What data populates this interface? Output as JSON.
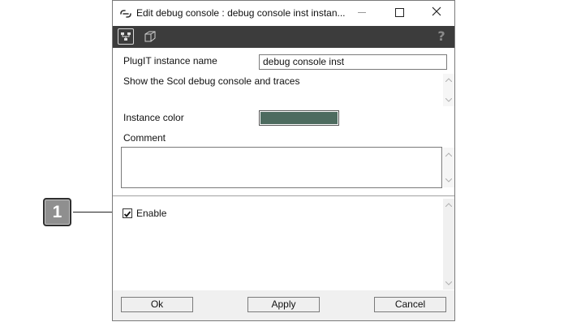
{
  "callout": {
    "number": "1"
  },
  "window": {
    "title": "Edit debug console : debug console inst instan...",
    "icons": {
      "app": "link-icon",
      "minimize": "minimize-icon",
      "maximize": "maximize-icon",
      "close": "close-icon"
    }
  },
  "toolbar": {
    "buttons": [
      {
        "icon": "hierarchy-icon"
      },
      {
        "icon": "cube-icon"
      }
    ],
    "help_label": "?"
  },
  "form": {
    "name_label": "PlugIT instance name",
    "name_value": "debug console inst",
    "description": "Show the Scol debug console and traces",
    "color_label": "Instance color",
    "color_value": "#4d6b5f",
    "comment_label": "Comment",
    "comment_value": ""
  },
  "options": {
    "enable_label": "Enable",
    "enable_checked": true
  },
  "footer": {
    "ok_label": "Ok",
    "apply_label": "Apply",
    "cancel_label": "Cancel"
  }
}
